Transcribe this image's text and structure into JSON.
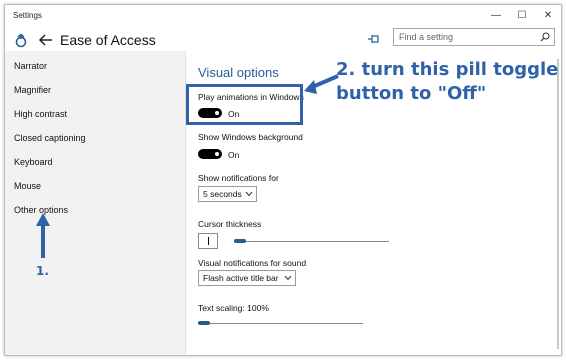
{
  "window": {
    "title": "Settings",
    "minimize": "—",
    "maximize": "☐",
    "close": "✕"
  },
  "header": {
    "title": "Ease of Access",
    "search_placeholder": "Find a setting"
  },
  "sidebar": {
    "items": [
      {
        "label": "Narrator"
      },
      {
        "label": "Magnifier"
      },
      {
        "label": "High contrast"
      },
      {
        "label": "Closed captioning"
      },
      {
        "label": "Keyboard"
      },
      {
        "label": "Mouse"
      },
      {
        "label": "Other options"
      }
    ]
  },
  "main": {
    "section_title": "Visual options",
    "play_animations": {
      "label": "Play animations in Windows",
      "state": "On"
    },
    "show_background": {
      "label": "Show Windows background",
      "state": "On"
    },
    "notifications_for": {
      "label": "Show notifications for",
      "value": "5 seconds"
    },
    "cursor_thickness": {
      "label": "Cursor thickness",
      "level": 0.06
    },
    "visual_notifications": {
      "label": "Visual notifications for sound",
      "value": "Flash active title bar"
    },
    "text_scaling": {
      "label": "Text scaling: 100%",
      "level": 0.0
    }
  },
  "annotations": {
    "step1": "1.",
    "step2_line1": "2. turn this pill toggle",
    "step2_line2": "button to \"Off\"",
    "color": "#2f62a9"
  },
  "colors": {
    "accent": "#2a5d9b",
    "slider": "#2c5a8d",
    "sidebar_bg": "#f2f2f2"
  }
}
